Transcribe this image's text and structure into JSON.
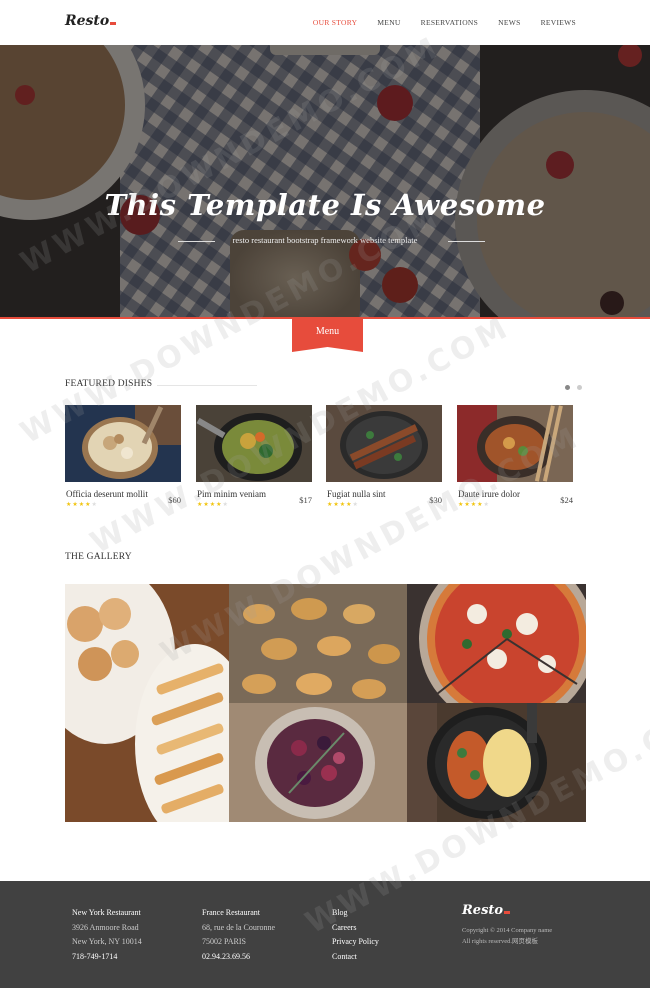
{
  "header": {
    "logo": "Resto",
    "nav": [
      {
        "label": "OUR STORY",
        "active": true
      },
      {
        "label": "MENU",
        "active": false
      },
      {
        "label": "RESERVATIONS",
        "active": false
      },
      {
        "label": "NEWS",
        "active": false
      },
      {
        "label": "REVIEWS",
        "active": false
      }
    ]
  },
  "hero": {
    "title": "This Template Is Awesome",
    "subtitle": "resto restaurant bootstrap framework website template"
  },
  "menu_tab": {
    "label": "Menu"
  },
  "featured": {
    "title": "FEATURED DISHES",
    "dishes": [
      {
        "name": "Officia deserunt mollit",
        "price": "$60",
        "rating": 4
      },
      {
        "name": "Pim minim veniam",
        "price": "$17",
        "rating": 4
      },
      {
        "name": "Fugiat nulla sint",
        "price": "$30",
        "rating": 4
      },
      {
        "name": "Daute irure dolor",
        "price": "$24",
        "rating": 4
      }
    ]
  },
  "gallery": {
    "title": "THE GALLERY"
  },
  "footer": {
    "col1": {
      "heading": "New York Restaurant",
      "line1": "3926 Anmoore Road",
      "line2": "New York, NY 10014",
      "phone": "718-749-1714"
    },
    "col2": {
      "heading": "France Restaurant",
      "line1": "68, rue de la Couronne",
      "line2": "75002 PARIS",
      "phone": "02.94.23.69.56"
    },
    "links": [
      "Blog",
      "Careers",
      "Privacy Policy",
      "Contact"
    ],
    "logo": "Resto",
    "copyright": "Copyright © 2014 Company name",
    "rights": "All rights reserved.网页模板"
  },
  "watermark": "WWW.DOWNDEMO.COM",
  "colors": {
    "accent": "#e74c3c",
    "footer_bg": "#414141",
    "star": "#f1c40f"
  }
}
